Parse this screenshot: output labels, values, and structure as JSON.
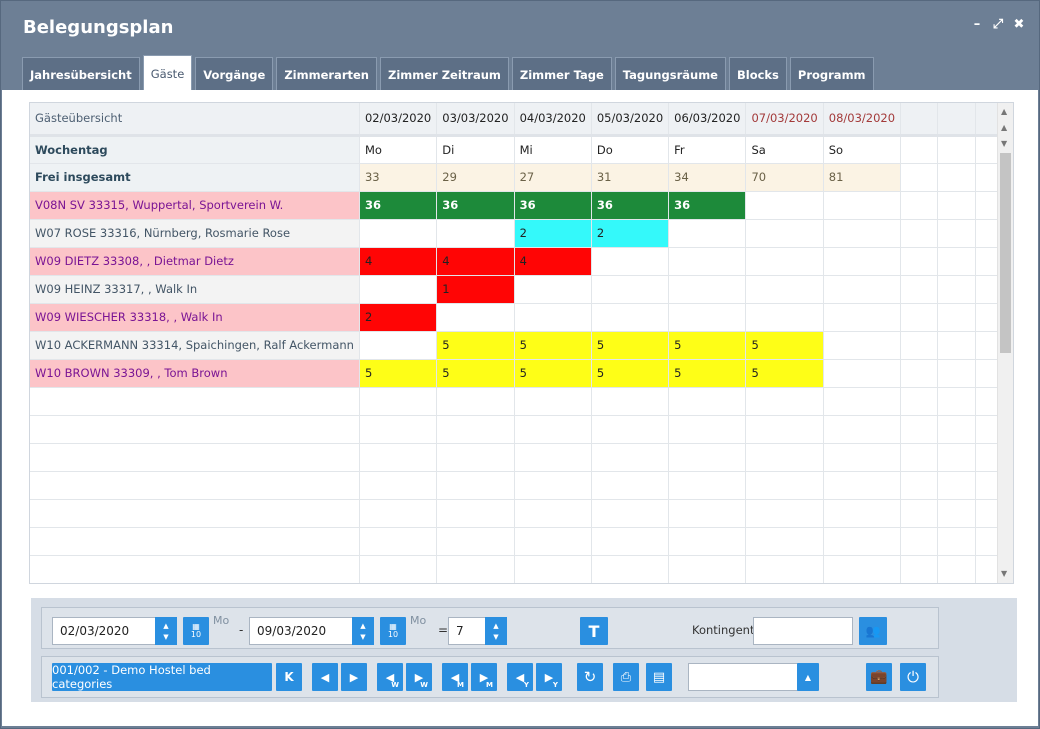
{
  "window": {
    "title": "Belegungsplan"
  },
  "tabs": [
    {
      "label": "Jahresübersicht"
    },
    {
      "label": "Gäste",
      "active": true
    },
    {
      "label": "Vorgänge"
    },
    {
      "label": "Zimmerarten"
    },
    {
      "label": "Zimmer Zeitraum"
    },
    {
      "label": "Zimmer Tage"
    },
    {
      "label": "Tagungsräume"
    },
    {
      "label": "Blocks"
    },
    {
      "label": "Programm"
    }
  ],
  "grid": {
    "header_label": "Gästeübersicht",
    "dates": [
      "02/03/2020",
      "03/03/2020",
      "04/03/2020",
      "05/03/2020",
      "06/03/2020",
      "07/03/2020",
      "08/03/2020"
    ],
    "weekend_flags": [
      false,
      false,
      false,
      false,
      false,
      true,
      true
    ],
    "weekday_label": "Wochentag",
    "weekdays": [
      "Mo",
      "Di",
      "Mi",
      "Do",
      "Fr",
      "Sa",
      "So"
    ],
    "free_label": "Frei insgesamt",
    "free_values": [
      "33",
      "29",
      "27",
      "31",
      "34",
      "70",
      "81"
    ],
    "guests": [
      {
        "name": "V08N SV 33315, Wuppertal, Sportverein W.",
        "style": "pink",
        "cells": [
          [
            "36",
            "green"
          ],
          [
            "36",
            "green"
          ],
          [
            "36",
            "green"
          ],
          [
            "36",
            "green"
          ],
          [
            "36",
            "green"
          ],
          [
            "",
            ""
          ],
          [
            "",
            ""
          ]
        ]
      },
      {
        "name": "W07 ROSE 33316, Nürnberg, Rosmarie Rose",
        "style": "plain",
        "cells": [
          [
            "",
            ""
          ],
          [
            "",
            ""
          ],
          [
            "2",
            "cyan"
          ],
          [
            "2",
            "cyan"
          ],
          [
            "",
            ""
          ],
          [
            "",
            ""
          ],
          [
            "",
            ""
          ]
        ]
      },
      {
        "name": "W09 DIETZ 33308, , Dietmar Dietz",
        "style": "pink",
        "cells": [
          [
            "4",
            "red"
          ],
          [
            "4",
            "red"
          ],
          [
            "4",
            "red"
          ],
          [
            "",
            ""
          ],
          [
            "",
            ""
          ],
          [
            "",
            ""
          ],
          [
            "",
            ""
          ]
        ]
      },
      {
        "name": "W09 HEINZ 33317, , Walk In",
        "style": "plain",
        "cells": [
          [
            "",
            ""
          ],
          [
            "1",
            "red"
          ],
          [
            "",
            ""
          ],
          [
            "",
            ""
          ],
          [
            "",
            ""
          ],
          [
            "",
            ""
          ],
          [
            "",
            ""
          ]
        ]
      },
      {
        "name": "W09 WIESCHER 33318, , Walk In",
        "style": "pink",
        "cells": [
          [
            "2",
            "red"
          ],
          [
            "",
            ""
          ],
          [
            "",
            ""
          ],
          [
            "",
            ""
          ],
          [
            "",
            ""
          ],
          [
            "",
            ""
          ],
          [
            "",
            ""
          ]
        ]
      },
      {
        "name": "W10 ACKERMANN 33314, Spaichingen, Ralf Ackermann",
        "style": "plain",
        "cells": [
          [
            "",
            ""
          ],
          [
            "5",
            "yellow"
          ],
          [
            "5",
            "yellow"
          ],
          [
            "5",
            "yellow"
          ],
          [
            "5",
            "yellow"
          ],
          [
            "5",
            "yellow"
          ],
          [
            "",
            ""
          ]
        ]
      },
      {
        "name": "W10 BROWN 33309, , Tom Brown",
        "style": "pink",
        "cells": [
          [
            "5",
            "yellow"
          ],
          [
            "5",
            "yellow"
          ],
          [
            "5",
            "yellow"
          ],
          [
            "5",
            "yellow"
          ],
          [
            "5",
            "yellow"
          ],
          [
            "5",
            "yellow"
          ],
          [
            "",
            ""
          ]
        ]
      }
    ],
    "empty_rows": 7,
    "extra_columns": 3
  },
  "controls": {
    "from_date": "02/03/2020",
    "from_weekday": "Mo",
    "separator": "-",
    "to_date": "09/03/2020",
    "to_weekday": "Mo",
    "equals": "=",
    "days": "7",
    "t_button": "T",
    "kontingent_label": "Kontingent:",
    "kontingent_value": "",
    "category_button": "001/002 - Demo Hostel bed categories",
    "k_button": "K",
    "week_sub": "W",
    "month_sub": "M",
    "year_sub": "Y",
    "cal_icon_text": "10",
    "select_value": ""
  },
  "colors": {
    "green": "#1d8a3a",
    "cyan": "#34f9fa",
    "red": "#ff0505",
    "yellow": "#fefe17",
    "pink_row": "#fcc4c8",
    "button_blue": "#2a8fe0",
    "titlebar": "#6d7f95"
  }
}
